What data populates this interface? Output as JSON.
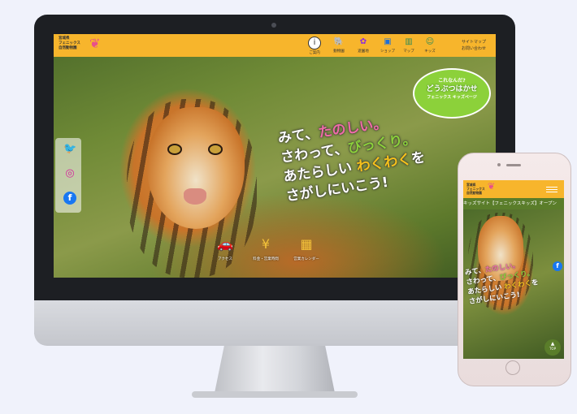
{
  "desktop": {
    "logo_text": [
      "宮城県",
      "フェニックス",
      "自然動物園"
    ],
    "nav": [
      {
        "label": "ご案内",
        "icon": "info-icon"
      },
      {
        "label": "動物園",
        "icon": "elephant-icon"
      },
      {
        "label": "遊園地",
        "icon": "flower-icon"
      },
      {
        "label": "ショップ",
        "icon": "shop-bag-icon"
      },
      {
        "label": "マップ",
        "icon": "map-icon"
      },
      {
        "label": "キッズ",
        "icon": "kids-icon"
      }
    ],
    "util_links": [
      "サイトマップ",
      "お問い合わせ"
    ],
    "badge": {
      "line1": "これなんだ?",
      "line2": "どうぶつはかせ",
      "line3": "フェニックス キッズページ"
    },
    "slogan": {
      "l1_a": "みて、",
      "l1_b": "たのしい。",
      "l2_a": "さわって、",
      "l2_b": "びっくり。",
      "l3_a": "あたらしい ",
      "l3_b": "わくわく",
      "l3_c": "を",
      "l4": "さがしにいこう!"
    },
    "social": [
      {
        "name": "twitter-icon",
        "glyph": "🐦",
        "color": "#1da1f2"
      },
      {
        "name": "instagram-icon",
        "glyph": "◎",
        "color": "#d6249f"
      },
      {
        "name": "facebook-icon",
        "glyph": "f",
        "color": "#1877f2"
      }
    ],
    "bottom_links": [
      {
        "label": "アクセス",
        "icon": "car-icon"
      },
      {
        "label": "料金・営業時間",
        "icon": "yen-clock-icon"
      },
      {
        "label": "営業カレンダー",
        "icon": "calendar-icon"
      }
    ]
  },
  "mobile": {
    "logo_text": [
      "宮城県",
      "フェニックス",
      "自然動物園"
    ],
    "ticker": "キッズサイト【フェニックスキッズ】オープン",
    "slogan": {
      "l1_a": "みて、",
      "l1_b": "たのしい。",
      "l2_a": "さわって、",
      "l2_b": "びっくり。",
      "l3_a": "あたらしい ",
      "l3_b": "わくわく",
      "l3_c": "を",
      "l4": "さがしにいこう!"
    },
    "top_button": "TOP"
  },
  "colors": {
    "brand_orange": "#f7b52c",
    "accent_green": "#8cd13a",
    "accent_pink": "#f06ca8"
  }
}
